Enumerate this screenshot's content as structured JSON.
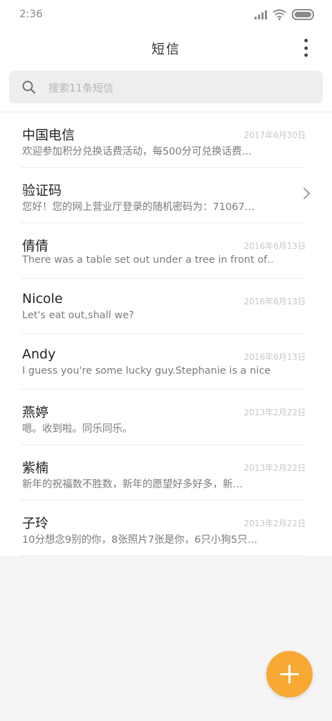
{
  "status_bar": {
    "time": "2:36",
    "icons": [
      "signal-icon",
      "wifi-icon",
      "battery-icon"
    ]
  },
  "header": {
    "title": "短信",
    "menu_icon": "more-vertical-icon"
  },
  "search": {
    "placeholder": "搜索11条短信",
    "icon": "search-icon"
  },
  "messages": [
    {
      "name": "中国电信",
      "date": "2017年6月30日",
      "snippet": "欢迎参加积分兑换话费活动，每500分可兑换话费…"
    },
    {
      "name": "验证码",
      "date": "",
      "snippet": "您好！您的网上营业厅登录的随机密码为：71067…",
      "has_chevron": true
    },
    {
      "name": "倩倩",
      "date": "2016年6月13日",
      "snippet": "There was a table set out under a tree in front of…"
    },
    {
      "name": "Nicole",
      "date": "2016年6月13日",
      "snippet": "Let's eat out,shall we?"
    },
    {
      "name": "Andy",
      "date": "2016年6月13日",
      "snippet": "I guess you're some lucky guy.Stephanie is a nice …"
    },
    {
      "name": "燕婷",
      "date": "2013年2月22日",
      "snippet": "嗯。收到啦。同乐同乐。"
    },
    {
      "name": "紫楠",
      "date": "2013年2月22日",
      "snippet": "新年的祝福数不胜数，新年的愿望好多好多，新…"
    },
    {
      "name": "子玲",
      "date": "2013年2月22日",
      "snippet": "10分想念9别的你，8张照片7张是你，6只小狗5只…"
    }
  ],
  "fab": {
    "icon": "plus-icon",
    "color": "#f7a934"
  }
}
